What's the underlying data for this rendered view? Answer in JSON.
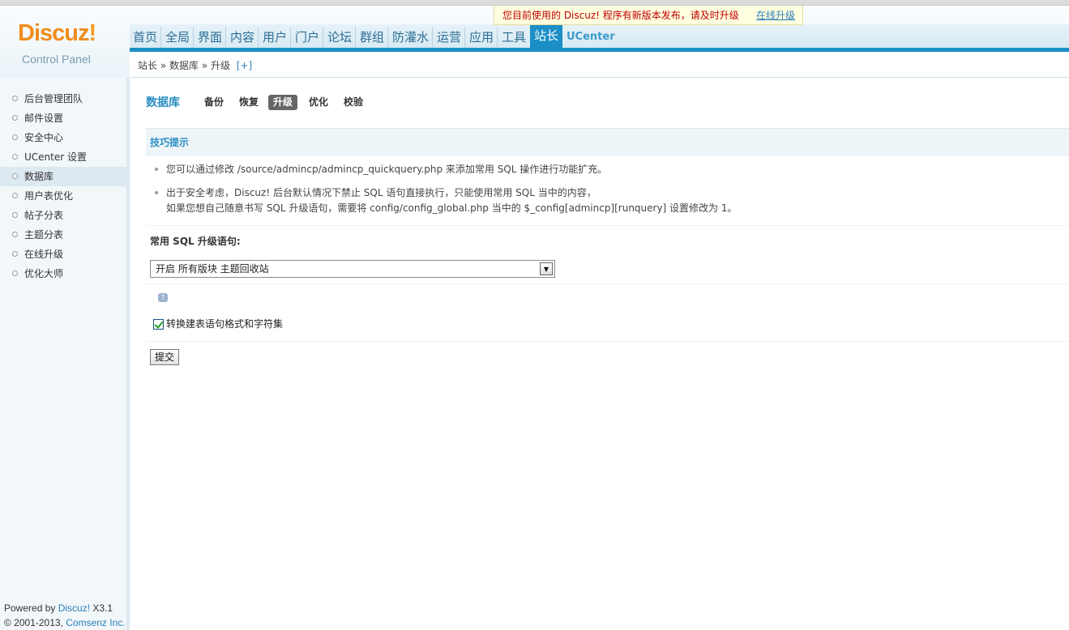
{
  "logo": {
    "main": "Discuz",
    "bang": "!",
    "sub": "Control Panel"
  },
  "notice": {
    "text": "您目前使用的 Discuz! 程序有新版本发布，请及时升级",
    "link": "在线升级"
  },
  "nav": {
    "items": [
      "首页",
      "全局",
      "界面",
      "内容",
      "用户",
      "门户",
      "论坛",
      "群组",
      "防灌水",
      "运营",
      "应用",
      "工具",
      "站长",
      "UCenter"
    ],
    "active": "站长"
  },
  "breadcrumb": {
    "path": "站长 » 数据库 » 升级",
    "toggle": "[+]"
  },
  "sidebar": {
    "items": [
      "后台管理团队",
      "邮件设置",
      "安全中心",
      "UCenter 设置",
      "数据库",
      "用户表优化",
      "帖子分表",
      "主题分表",
      "在线升级",
      "优化大师"
    ],
    "active": "数据库",
    "footer_line1_prefix": "Powered by ",
    "footer_line1_brand": "Discuz!",
    "footer_line1_version": " X3.1",
    "footer_line2_prefix": "© 2001-2013, ",
    "footer_line2_link": "Comsenz Inc."
  },
  "section": {
    "title": "数据库",
    "tabs": [
      "备份",
      "恢复",
      "升级",
      "优化",
      "校验"
    ],
    "active_tab": "升级"
  },
  "tips": {
    "title": "技巧提示",
    "line1": "您可以通过修改 /source/admincp/admincp_quickquery.php 来添加常用 SQL 操作进行功能扩充。",
    "line2a": "出于安全考虑，Discuz! 后台默认情况下禁止 SQL 语句直接执行，只能使用常用 SQL 当中的内容，",
    "line2b": "如果您想自己随意书写 SQL 升级语句，需要将 config/config_global.php 当中的 $_config[admincp][runquery] 设置修改为 1。"
  },
  "form": {
    "sql_label": "常用 SQL 升级语句:",
    "select_value": "开启 所有版块 主题回收站",
    "checkbox_label": "转换建表语句格式和字符集",
    "checkbox_checked": true,
    "submit_label": "提交"
  }
}
